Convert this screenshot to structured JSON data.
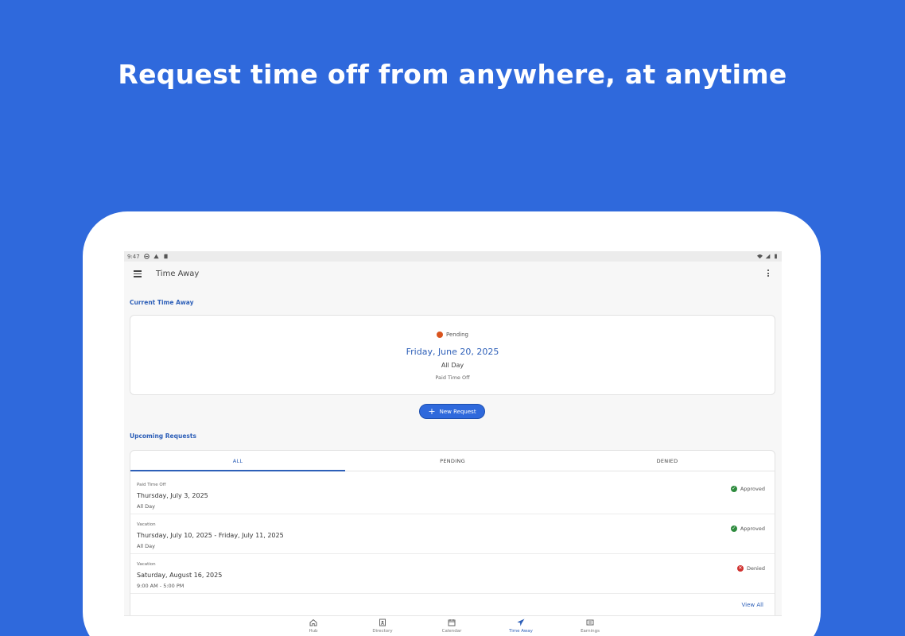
{
  "headline": "Request time off from anywhere, at anytime",
  "status_bar": {
    "time": "9:47"
  },
  "app_bar": {
    "title": "Time Away"
  },
  "current": {
    "section_label": "Current Time Away",
    "status": "Pending",
    "date": "Friday, June 20, 2025",
    "span": "All Day",
    "type": "Paid Time Off"
  },
  "new_request_label": "New Request",
  "upcoming": {
    "section_label": "Upcoming Requests",
    "tabs": [
      {
        "label": "ALL",
        "active": true
      },
      {
        "label": "PENDING",
        "active": false
      },
      {
        "label": "DENIED",
        "active": false
      }
    ],
    "requests": [
      {
        "type": "Paid Time Off",
        "date": "Thursday, July 3, 2025",
        "span": "All Day",
        "status": "Approved"
      },
      {
        "type": "Vacation",
        "date": "Thursday, July 10, 2025 - Friday, July 11, 2025",
        "span": "All Day",
        "status": "Approved"
      },
      {
        "type": "Vacation",
        "date": "Saturday, August 16, 2025",
        "span": "9:00 AM - 5:00 PM",
        "status": "Denied"
      }
    ],
    "view_all": "View All"
  },
  "bottom_nav": [
    {
      "label": "Hub",
      "icon": "home-icon"
    },
    {
      "label": "Directory",
      "icon": "directory-icon"
    },
    {
      "label": "Calendar",
      "icon": "calendar-icon"
    },
    {
      "label": "Time Away",
      "icon": "airplane-icon",
      "active": true
    },
    {
      "label": "Earnings",
      "icon": "earnings-icon"
    }
  ],
  "colors": {
    "brand": "#2f69dc",
    "accent": "#2d5fb8",
    "approved": "#2e8b3e",
    "denied": "#d0302e",
    "pending": "#d9541e"
  }
}
